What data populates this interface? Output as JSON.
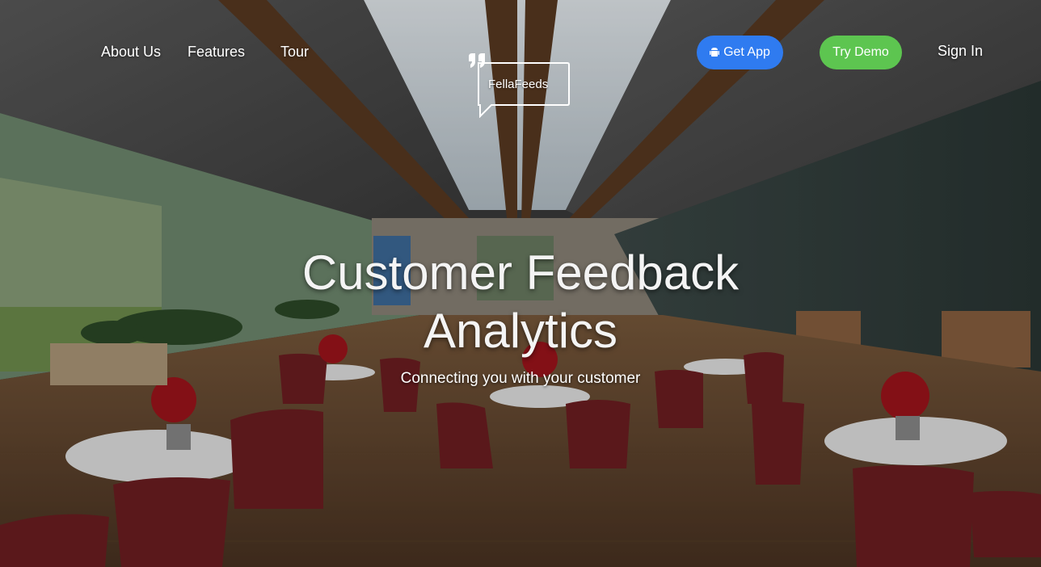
{
  "nav": {
    "about": "About Us",
    "features": "Features",
    "tour": "Tour",
    "sign_in": "Sign In"
  },
  "buttons": {
    "get_app": "Get App",
    "get_app_icon": "android-icon",
    "try_demo": "Try Demo"
  },
  "logo": {
    "text": "FellaFeeds",
    "icon": "quote-speech-bubble-icon"
  },
  "hero": {
    "title": "Customer Feedback Analytics",
    "subtitle": "Connecting you with your customer"
  },
  "colors": {
    "get_app_bg": "#2f7bf0",
    "try_demo_bg": "#5dc550",
    "text": "#ffffff"
  }
}
